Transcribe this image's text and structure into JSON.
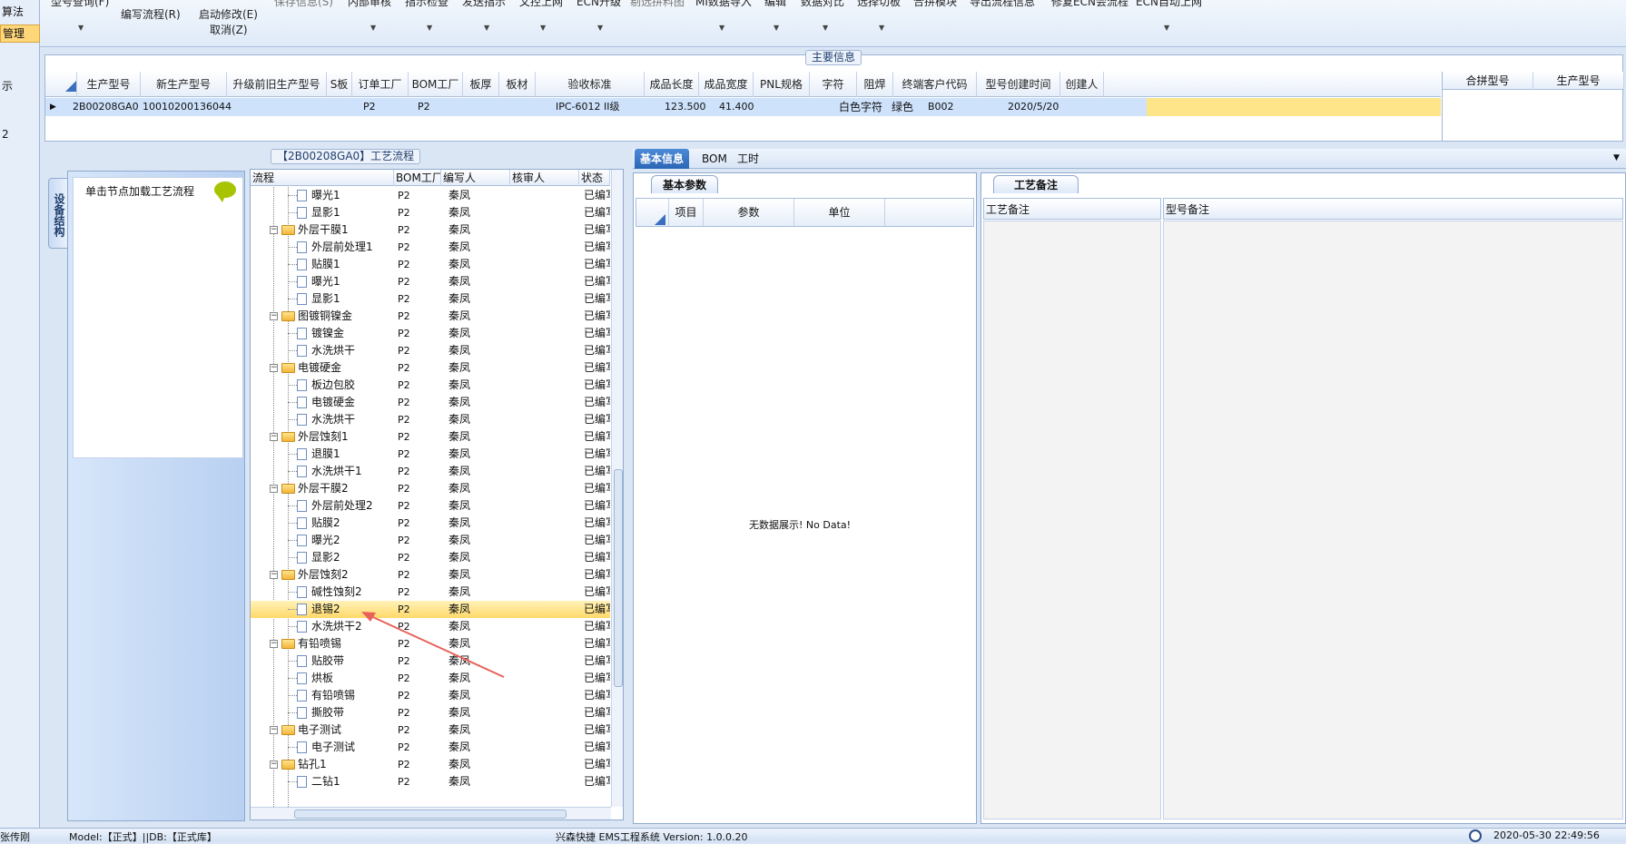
{
  "left_strip": {
    "items": [
      "算法",
      "管理",
      "示",
      "2"
    ]
  },
  "ribbon": {
    "row1": [
      "型号查询(F)",
      "保存信息(S)",
      "内部审核",
      "指示检查",
      "发送指示",
      "文控上网",
      "ECN升级",
      "剔选拼料图",
      "MI数据导入",
      "编辑",
      "数据对比",
      "选择切板",
      "合拼模块",
      "导出流程信息",
      "修复ECN会流程",
      "ECN自动上网"
    ],
    "row2_edit_flow": "编写流程(R)",
    "row2_start_modify": "启动修改(E)",
    "row3_cancel": "取消(Z)"
  },
  "main_info": {
    "title": "主要信息",
    "headers": [
      "生产型号",
      "新生产型号",
      "升级前旧生产型号",
      "S板",
      "订单工厂",
      "BOM工厂",
      "板厚",
      "板材",
      "验收标准",
      "成品长度",
      "成品宽度",
      "PNL规格",
      "字符",
      "阻焊",
      "终端客户代码",
      "型号创建时间",
      "创建人"
    ],
    "row": {
      "model": "2B00208GA0",
      "new_model": "10010200136044",
      "old_model": "",
      "s_board": "",
      "order_factory": "P2",
      "bom_factory": "P2",
      "thickness": "",
      "material": "",
      "standard": "IPC-6012 II级",
      "length": "123.500",
      "width": "41.400",
      "pnl": "",
      "silkscreen": "白色字符",
      "soldermask": "绿色",
      "customer_code": "B002",
      "created": "2020/5/20",
      "creator": ""
    },
    "right_headers": [
      "合拼型号",
      "生产型号"
    ]
  },
  "left_panel": {
    "vertical_tab": "设备结构",
    "hint": "单击节点加载工艺流程"
  },
  "flow": {
    "title": "【2B00208GA0】工艺流程",
    "headers": [
      "流程",
      "BOM工厂",
      "编写人",
      "核审人",
      "状态"
    ],
    "rows": [
      {
        "name": "曝光1",
        "kind": "file",
        "factory": "P2",
        "author": "秦凤",
        "status": "已编写"
      },
      {
        "name": "显影1",
        "kind": "file",
        "factory": "P2",
        "author": "秦凤",
        "status": "已编写"
      },
      {
        "name": "外层干膜1",
        "kind": "folder",
        "factory": "P2",
        "author": "秦凤",
        "status": "已编写"
      },
      {
        "name": "外层前处理1",
        "kind": "file",
        "factory": "P2",
        "author": "秦凤",
        "status": "已编写"
      },
      {
        "name": "贴膜1",
        "kind": "file",
        "factory": "P2",
        "author": "秦凤",
        "status": "已编写"
      },
      {
        "name": "曝光1",
        "kind": "file",
        "factory": "P2",
        "author": "秦凤",
        "status": "已编写"
      },
      {
        "name": "显影1",
        "kind": "file",
        "factory": "P2",
        "author": "秦凤",
        "status": "已编写"
      },
      {
        "name": "图镀铜镍金",
        "kind": "folder",
        "factory": "P2",
        "author": "秦凤",
        "status": "已编写"
      },
      {
        "name": "镀镍金",
        "kind": "file",
        "factory": "P2",
        "author": "秦凤",
        "status": "已编写"
      },
      {
        "name": "水洗烘干",
        "kind": "file",
        "factory": "P2",
        "author": "秦凤",
        "status": "已编写"
      },
      {
        "name": "电镀硬金",
        "kind": "folder",
        "factory": "P2",
        "author": "秦凤",
        "status": "已编写"
      },
      {
        "name": "板边包胶",
        "kind": "file",
        "factory": "P2",
        "author": "秦凤",
        "status": "已编写"
      },
      {
        "name": "电镀硬金",
        "kind": "file",
        "factory": "P2",
        "author": "秦凤",
        "status": "已编写"
      },
      {
        "name": "水洗烘干",
        "kind": "file",
        "factory": "P2",
        "author": "秦凤",
        "status": "已编写"
      },
      {
        "name": "外层蚀刻1",
        "kind": "folder",
        "factory": "P2",
        "author": "秦凤",
        "status": "已编写"
      },
      {
        "name": "退膜1",
        "kind": "file",
        "factory": "P2",
        "author": "秦凤",
        "status": "已编写"
      },
      {
        "name": "水洗烘干1",
        "kind": "file",
        "factory": "P2",
        "author": "秦凤",
        "status": "已编写"
      },
      {
        "name": "外层干膜2",
        "kind": "folder",
        "factory": "P2",
        "author": "秦凤",
        "status": "已编写"
      },
      {
        "name": "外层前处理2",
        "kind": "file",
        "factory": "P2",
        "author": "秦凤",
        "status": "已编写"
      },
      {
        "name": "贴膜2",
        "kind": "file",
        "factory": "P2",
        "author": "秦凤",
        "status": "已编写"
      },
      {
        "name": "曝光2",
        "kind": "file",
        "factory": "P2",
        "author": "秦凤",
        "status": "已编写"
      },
      {
        "name": "显影2",
        "kind": "file",
        "factory": "P2",
        "author": "秦凤",
        "status": "已编写"
      },
      {
        "name": "外层蚀刻2",
        "kind": "folder",
        "factory": "P2",
        "author": "秦凤",
        "status": "已编写"
      },
      {
        "name": "碱性蚀刻2",
        "kind": "file",
        "factory": "P2",
        "author": "秦凤",
        "status": "已编写"
      },
      {
        "name": "退锡2",
        "kind": "file",
        "factory": "P2",
        "author": "秦凤",
        "status": "已编写",
        "selected": true
      },
      {
        "name": "水洗烘干2",
        "kind": "file",
        "factory": "P2",
        "author": "秦凤",
        "status": "已编写"
      },
      {
        "name": "有铅喷锡",
        "kind": "folder",
        "factory": "P2",
        "author": "秦凤",
        "status": "已编写"
      },
      {
        "name": "贴胶带",
        "kind": "file",
        "factory": "P2",
        "author": "秦凤",
        "status": "已编写"
      },
      {
        "name": "烘板",
        "kind": "file",
        "factory": "P2",
        "author": "秦凤",
        "status": "已编写"
      },
      {
        "name": "有铅喷锡",
        "kind": "file",
        "factory": "P2",
        "author": "秦凤",
        "status": "已编写"
      },
      {
        "name": "撕胶带",
        "kind": "file",
        "factory": "P2",
        "author": "秦凤",
        "status": "已编写"
      },
      {
        "name": "电子测试",
        "kind": "folder",
        "factory": "P2",
        "author": "秦凤",
        "status": "已编写"
      },
      {
        "name": "电子测试",
        "kind": "file",
        "factory": "P2",
        "author": "秦凤",
        "status": "已编写"
      },
      {
        "name": "钻孔1",
        "kind": "folder",
        "factory": "P2",
        "author": "秦凤",
        "status": "已编写"
      },
      {
        "name": "二钻1",
        "kind": "file",
        "factory": "P2",
        "author": "秦凤",
        "status": "已编写"
      }
    ]
  },
  "right_tabs": [
    "基本信息",
    "BOM",
    "工时"
  ],
  "params": {
    "tab": "基本参数",
    "headers": [
      "项目",
      "参数",
      "单位"
    ],
    "empty": "无数据展示! No Data!"
  },
  "notes": {
    "tab": "工艺备注",
    "col1": "工艺备注",
    "col2": "型号备注"
  },
  "status_bar": {
    "user": "张传刚",
    "model_db": "Model:【正式】||DB:【正式库】",
    "app": "兴森快捷 EMS工程系统 Version: 1.0.0.20",
    "time": "2020-05-30 22:49:56"
  },
  "colors": {
    "selection": "#ffd96a",
    "tab_active": "#2b66b6",
    "arrow": "#e8625a"
  }
}
